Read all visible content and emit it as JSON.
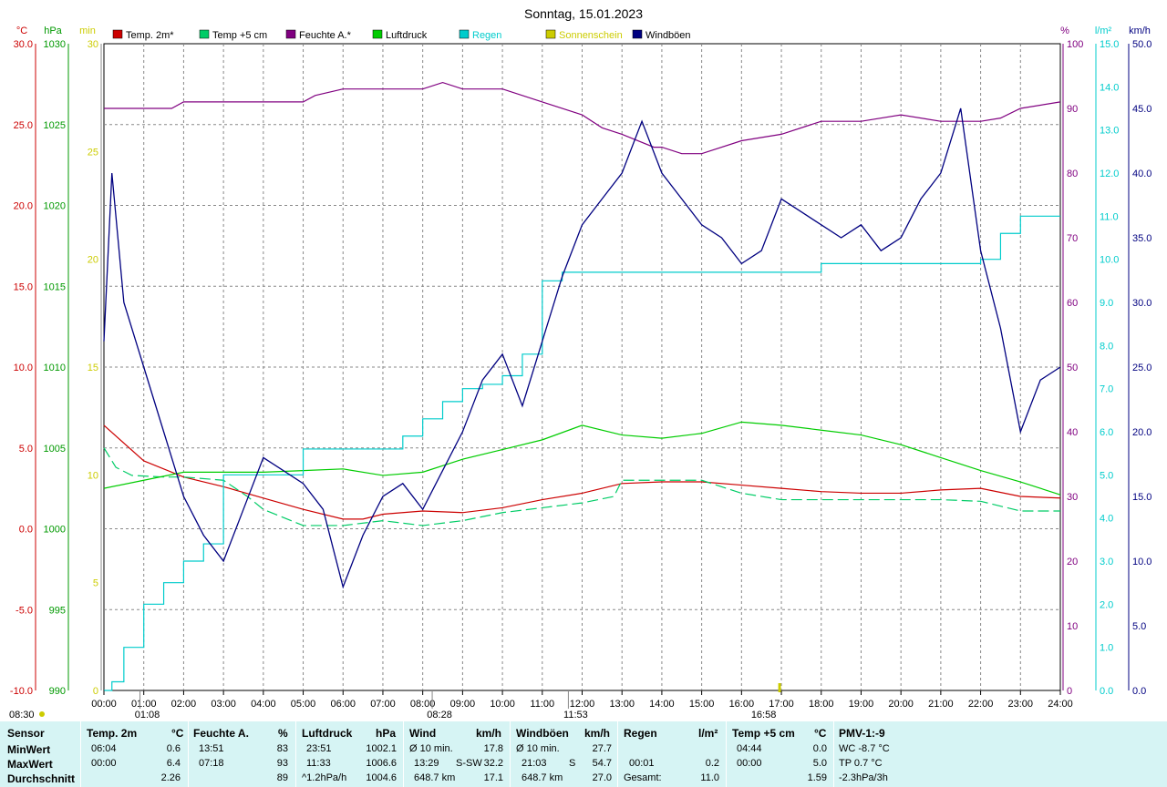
{
  "chart_data": {
    "type": "line",
    "title": "Sonntag, 15.01.2023",
    "x_ticks": [
      "00:00",
      "01:00",
      "02:00",
      "03:00",
      "04:00",
      "05:00",
      "06:00",
      "07:00",
      "08:00",
      "09:00",
      "10:00",
      "11:00",
      "12:00",
      "13:00",
      "14:00",
      "15:00",
      "16:00",
      "17:00",
      "18:00",
      "19:00",
      "20:00",
      "21:00",
      "22:00",
      "23:00",
      "24:00"
    ],
    "axes": [
      {
        "id": "temp",
        "unit": "°C",
        "min": -10,
        "max": 30,
        "ticks": [
          "30.0",
          "25.0",
          "20.0",
          "15.0",
          "10.0",
          "5.0",
          "0.0",
          "-5.0",
          "-10.0"
        ],
        "color": "#cc0000"
      },
      {
        "id": "press",
        "unit": "hPa",
        "min": 990,
        "max": 1030,
        "ticks": [
          "1030",
          "1025",
          "1020",
          "1015",
          "1010",
          "1005",
          "1000",
          "995",
          "990"
        ],
        "color": "#009900"
      },
      {
        "id": "sun",
        "unit": "min",
        "min": 0,
        "max": 30,
        "ticks": [
          "30",
          "25",
          "20",
          "15",
          "10",
          "5",
          "0"
        ],
        "color": "#cccc00"
      },
      {
        "id": "hum",
        "unit": "%",
        "min": 0,
        "max": 100,
        "ticks": [
          "100",
          "90",
          "80",
          "70",
          "60",
          "50",
          "40",
          "30",
          "20",
          "10",
          "0"
        ],
        "color": "#800080"
      },
      {
        "id": "rain",
        "unit": "l/m²",
        "min": 0,
        "max": 15,
        "ticks": [
          "15.0",
          "14.0",
          "13.0",
          "12.0",
          "11.0",
          "10.0",
          "9.0",
          "8.0",
          "7.0",
          "6.0",
          "5.0",
          "4.0",
          "3.0",
          "2.0",
          "1.0",
          "0.0"
        ],
        "color": "#00cccc"
      },
      {
        "id": "wind",
        "unit": "km/h",
        "min": 0,
        "max": 50,
        "ticks": [
          "50.0",
          "45.0",
          "40.0",
          "35.0",
          "30.0",
          "25.0",
          "20.0",
          "15.0",
          "10.0",
          "5.0",
          "0.0"
        ],
        "color": "#000080"
      }
    ],
    "legend": [
      {
        "name": "Temp. 2m*",
        "color": "#cc0000"
      },
      {
        "name": "Temp +5 cm",
        "color": "#00cc66"
      },
      {
        "name": "Feuchte A.*",
        "color": "#800080"
      },
      {
        "name": "Luftdruck",
        "color": "#00cc00"
      },
      {
        "name": "Regen",
        "color": "#00cccc"
      },
      {
        "name": "Sonnenschein",
        "color": "#cccc00"
      },
      {
        "name": "Windböen",
        "color": "#000080"
      }
    ],
    "series": [
      {
        "name": "Temp. 2m*",
        "axis": "temp",
        "color": "#cc0000",
        "style": "solid",
        "x": [
          0,
          1,
          2,
          3,
          4,
          5,
          6,
          6.5,
          7,
          8,
          9,
          10,
          11,
          12,
          13,
          14,
          15,
          16,
          17,
          18,
          19,
          20,
          21,
          22,
          23,
          24
        ],
        "y": [
          6.4,
          4.2,
          3.2,
          2.6,
          1.9,
          1.2,
          0.6,
          0.6,
          0.9,
          1.1,
          1.0,
          1.3,
          1.8,
          2.2,
          2.8,
          2.9,
          2.9,
          2.7,
          2.5,
          2.3,
          2.2,
          2.2,
          2.4,
          2.5,
          2.0,
          1.9
        ]
      },
      {
        "name": "Temp +5 cm",
        "axis": "temp",
        "color": "#00cc66",
        "style": "dashed",
        "x": [
          0,
          0.3,
          0.7,
          1.5,
          2,
          3,
          3.6,
          4,
          5,
          6,
          7,
          8,
          9,
          10,
          11,
          12,
          12.8,
          13,
          14,
          15,
          16,
          17,
          18,
          19,
          20,
          21,
          22,
          23,
          24
        ],
        "y": [
          5.0,
          3.8,
          3.3,
          3.2,
          3.2,
          3.0,
          2.0,
          1.2,
          0.2,
          0.2,
          0.5,
          0.2,
          0.5,
          1.0,
          1.3,
          1.6,
          2.0,
          3.0,
          3.0,
          3.0,
          2.2,
          1.8,
          1.8,
          1.8,
          1.8,
          1.8,
          1.7,
          1.1,
          1.1
        ]
      },
      {
        "name": "Feuchte A.*",
        "axis": "hum",
        "color": "#800080",
        "style": "solid",
        "x": [
          0,
          1,
          1.7,
          2,
          4,
          5,
          5.3,
          6,
          8,
          8.5,
          9,
          10,
          11,
          12,
          12.5,
          13,
          13.8,
          14,
          14.5,
          15,
          16,
          17,
          18,
          19,
          20,
          21,
          22,
          22.5,
          23,
          24
        ],
        "y": [
          90,
          90,
          90,
          91,
          91,
          91,
          92,
          93,
          93,
          94,
          93,
          93,
          91,
          89,
          87,
          86,
          84,
          84,
          83,
          83,
          85,
          86,
          88,
          88,
          89,
          88,
          88,
          88.5,
          90,
          91
        ]
      },
      {
        "name": "Luftdruck",
        "axis": "press",
        "color": "#00cc00",
        "style": "solid",
        "x": [
          0,
          1,
          2,
          3,
          4,
          5,
          6,
          7,
          8,
          9,
          10,
          11,
          12,
          13,
          14,
          15,
          16,
          17,
          18,
          19,
          20,
          21,
          22,
          23,
          24
        ],
        "y": [
          1002.5,
          1003.0,
          1003.5,
          1003.5,
          1003.5,
          1003.6,
          1003.7,
          1003.3,
          1003.5,
          1004.3,
          1004.9,
          1005.5,
          1006.4,
          1005.8,
          1005.6,
          1005.9,
          1006.6,
          1006.4,
          1006.1,
          1005.8,
          1005.2,
          1004.4,
          1003.6,
          1002.9,
          1002.1
        ]
      },
      {
        "name": "Regen",
        "axis": "rain",
        "color": "#00cccc",
        "style": "step",
        "x": [
          0,
          0.2,
          0.5,
          1,
          1.5,
          2,
          2.5,
          3,
          5,
          7,
          7.5,
          8,
          8.5,
          9,
          9.5,
          10,
          10.5,
          11,
          11.5,
          12,
          13,
          16,
          18,
          19,
          21,
          22,
          22.5,
          23,
          24
        ],
        "y": [
          0,
          0.2,
          1.0,
          2.0,
          2.5,
          3.0,
          3.4,
          5.0,
          5.6,
          5.6,
          5.9,
          6.3,
          6.7,
          7.0,
          7.1,
          7.3,
          7.8,
          9.5,
          9.7,
          9.7,
          9.7,
          9.7,
          9.9,
          9.9,
          9.9,
          10.0,
          10.6,
          11.0,
          11.0
        ]
      },
      {
        "name": "Windböen",
        "axis": "wind",
        "color": "#000080",
        "style": "solid",
        "x": [
          0,
          0.2,
          0.5,
          1,
          1.5,
          2,
          2.5,
          3,
          3.5,
          4,
          4.5,
          5,
          5.5,
          6,
          6.5,
          7,
          7.5,
          8,
          8.5,
          9,
          9.5,
          10,
          10.5,
          11,
          11.5,
          12,
          12.5,
          13,
          13.5,
          14,
          14.5,
          15,
          15.5,
          16,
          16.5,
          17,
          17.5,
          18,
          18.5,
          19,
          19.5,
          20,
          20.5,
          21,
          21.5,
          22,
          22.5,
          23,
          23.5,
          24
        ],
        "y": [
          27,
          40,
          30,
          25,
          20,
          15,
          12,
          10,
          14,
          18,
          17,
          16,
          14,
          8,
          12,
          15,
          16,
          14,
          17,
          20,
          24,
          26,
          22,
          27,
          32,
          36,
          38,
          40,
          44,
          40,
          38,
          36,
          35,
          33,
          34,
          38,
          37,
          36,
          35,
          36,
          34,
          35,
          38,
          40,
          45,
          34,
          28,
          20,
          24,
          25
        ]
      }
    ],
    "markers": [
      {
        "x": "01:08",
        "type": "min-temp-marker"
      },
      {
        "x": "08:28",
        "type": "sun"
      },
      {
        "x": "11:53",
        "type": "max-marker"
      },
      {
        "x": "16:58",
        "type": "sun"
      }
    ],
    "sun_times": {
      "sunrise": "08:30",
      "sunset": "16:58",
      "marker_times": [
        "01:08",
        "08:28",
        "11:53"
      ]
    }
  },
  "stats": {
    "header": {
      "sensor": "Sensor",
      "temp": "Temp. 2m",
      "temp_u": "°C",
      "feuchte": "Feuchte A.",
      "feuchte_u": "%",
      "luft": "Luftdruck",
      "luft_u": "hPa",
      "wind": "Wind",
      "wind_u": "km/h",
      "boen": "Windböen",
      "boen_u": "km/h",
      "regen": "Regen",
      "regen_u": "l/m²",
      "t5": "Temp +5 cm",
      "t5_u": "°C",
      "pmv": "PMV-1:-9"
    },
    "rows": [
      {
        "label": "MinWert",
        "temp_t": "06:04",
        "temp_v": "0.6",
        "feu_t": "13:51",
        "feu_v": "83",
        "luft_t": "23:51",
        "luft_v": "1002.1",
        "wind_t": "Ø 10 min.",
        "wind_d": "",
        "wind_v": "17.8",
        "boen_t": "Ø 10 min.",
        "boen_d": "",
        "boen_v": "27.7",
        "regen_t": "",
        "regen_v": "",
        "t5_t": "04:44",
        "t5_v": "0.0",
        "pmv": "WC -8.7 °C"
      },
      {
        "label": "MaxWert",
        "temp_t": "00:00",
        "temp_v": "6.4",
        "feu_t": "07:18",
        "feu_v": "93",
        "luft_t": "11:33",
        "luft_v": "1006.6",
        "wind_t": "13:29",
        "wind_d": "S-SW",
        "wind_v": "32.2",
        "boen_t": "21:03",
        "boen_d": "S",
        "boen_v": "54.7",
        "regen_t": "00:01",
        "regen_v": "0.2",
        "t5_t": "00:00",
        "t5_v": "5.0",
        "pmv": "TP 0.7 °C"
      },
      {
        "label": "Durchschnitt",
        "temp_t": "",
        "temp_v": "2.26",
        "feu_t": "",
        "feu_v": "89",
        "luft_t": "^1.2hPa/h",
        "luft_v": "1004.6",
        "wind_t": "648.7 km",
        "wind_d": "",
        "wind_v": "17.1",
        "boen_t": "648.7 km",
        "boen_d": "",
        "boen_v": "27.0",
        "regen_t": "Gesamt:",
        "regen_v": "11.0",
        "t5_t": "",
        "t5_v": "1.59",
        "pmv": "-2.3hPa/3h"
      }
    ]
  }
}
